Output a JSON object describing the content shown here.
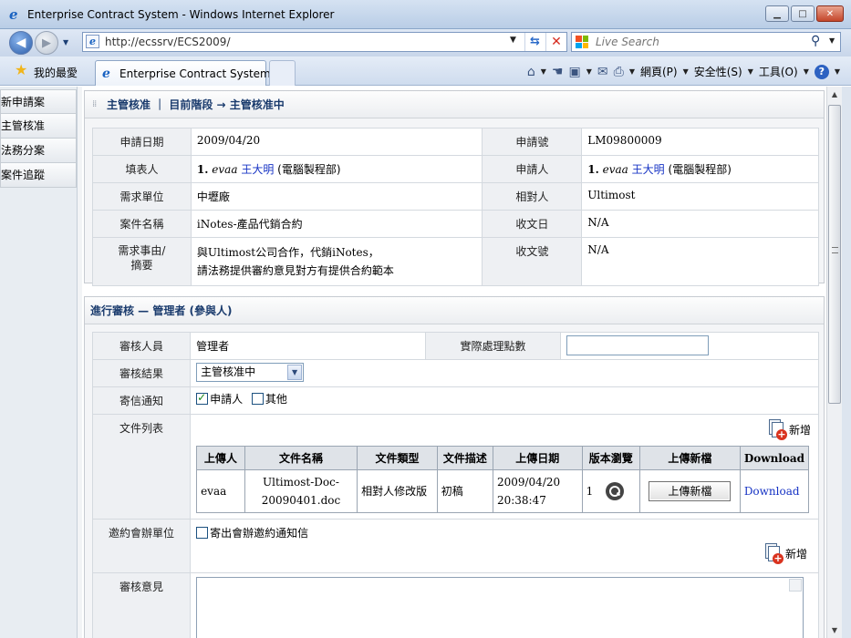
{
  "window": {
    "title": "Enterprise Contract System - Windows Internet Explorer",
    "minimize": "▁",
    "maximize": "□",
    "close": "✕"
  },
  "address": {
    "url": "http://ecssrv/ECS2009/",
    "search_placeholder": "Live Search"
  },
  "tabs": {
    "favorites": "我的最愛",
    "active_tab": "Enterprise Contract System"
  },
  "commandbar": {
    "page": "網頁(P)",
    "safety": "安全性(S)",
    "tools": "工具(O)"
  },
  "sidebar": {
    "items": [
      {
        "label": "新申請案"
      },
      {
        "label": "主管核准"
      },
      {
        "label": "法務分案"
      },
      {
        "label": "案件追蹤"
      }
    ]
  },
  "section1": {
    "title": "主管核准 ｜ 目前階段 → 主管核准中",
    "apply_date_label": "申請日期",
    "apply_date": "2009/04/20",
    "apply_no_label": "申請號",
    "apply_no": "LM09800009",
    "filler_label": "填表人",
    "filler_num": "1.",
    "filler_id": "evaa",
    "filler_name": "王大明",
    "filler_dept": "(電腦製程部)",
    "applicant_label": "申請人",
    "applicant_num": "1.",
    "applicant_id": "evaa",
    "applicant_name": "王大明",
    "applicant_dept": "(電腦製程部)",
    "unit_label": "需求單位",
    "unit": "中壢廠",
    "counterparty_label": "相對人",
    "counterparty": "Ultimost",
    "case_label": "案件名稱",
    "case_name": "iNotes-產品代銷合約",
    "receive_date_label": "收文日",
    "receive_date": "N/A",
    "reason_label": "需求事由/摘要",
    "reason_line1": "與Ultimost公司合作，代銷iNotes，",
    "reason_line2": "請法務提供審約意見對方有提供合約範本",
    "receive_no_label": "收文號",
    "receive_no": "N/A"
  },
  "section2": {
    "title": "進行審核 — 管理者 (參與人)",
    "reviewer_label": "審核人員",
    "reviewer": "管理者",
    "points_label": "實際處理點數",
    "points_value": "",
    "result_label": "審核結果",
    "result_value": "主管核准中",
    "mail_label": "寄信通知",
    "mail_applicant": "申請人",
    "mail_other": "其他",
    "files_label": "文件列表",
    "add_label": "新增",
    "file_headers": [
      "上傳人",
      "文件名稱",
      "文件類型",
      "文件描述",
      "上傳日期",
      "版本瀏覽",
      "上傳新檔",
      "Download"
    ],
    "file_row": {
      "uploader": "evaa",
      "name_line1": "Ultimost-Doc-",
      "name_line2": "20090401.doc",
      "type": "相對人修改版",
      "desc": "初稿",
      "date_line1": "2009/04/20",
      "date_line2": "20:38:47",
      "version": "1",
      "upload_button": "上傳新檔",
      "download_link": "Download"
    },
    "invite_label": "邀約會辦單位",
    "invite_checkbox": "寄出會辦邀約通知信",
    "opinion_label": "審核意見"
  }
}
